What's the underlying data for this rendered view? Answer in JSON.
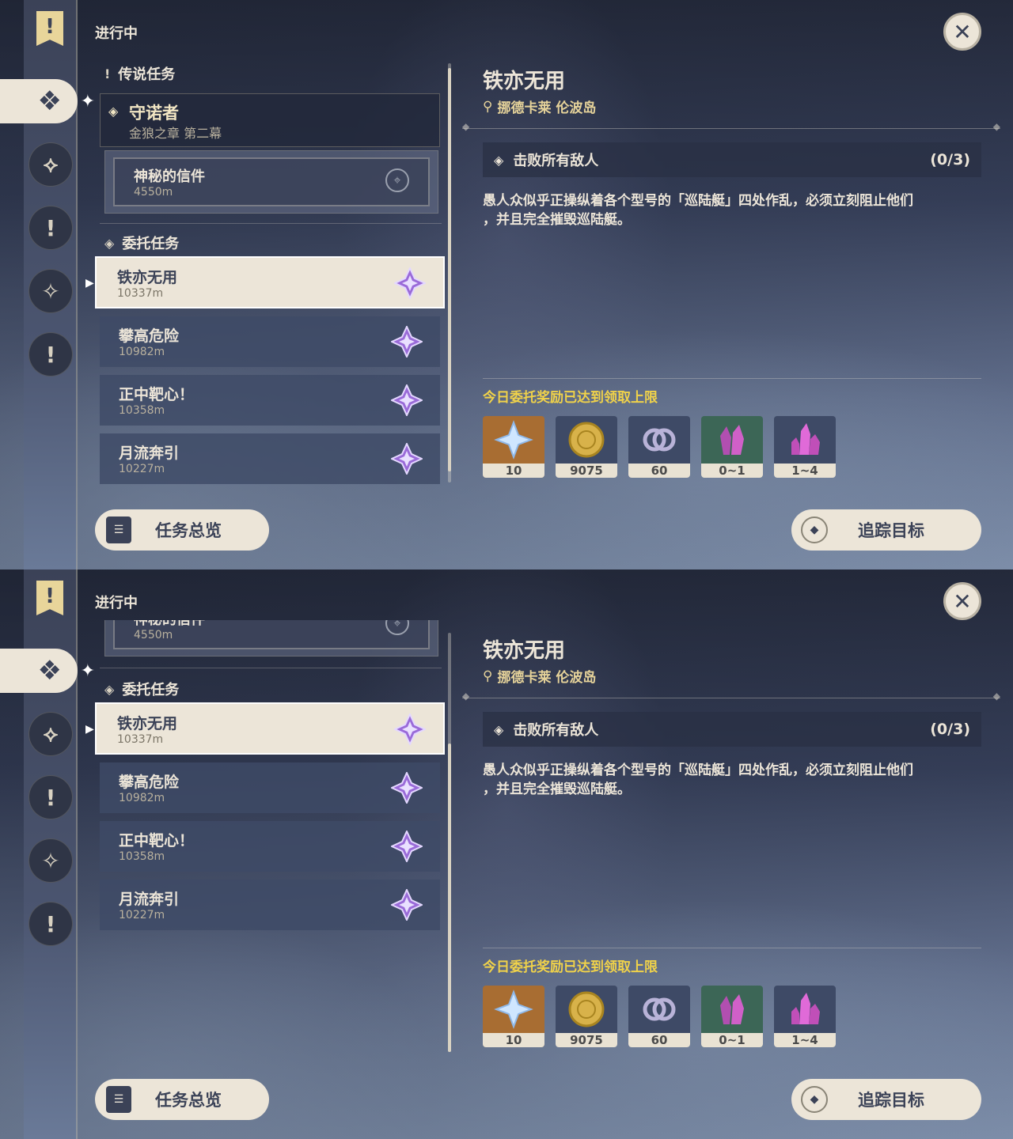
{
  "header": {
    "section_label": "进行中"
  },
  "categories": {
    "legend": "传说任务",
    "commission": "委托任务"
  },
  "legend_quest": {
    "title": "守诺者",
    "subtitle": "金狼之章 第二幕"
  },
  "legend_sub": {
    "title": "神秘的信件",
    "distance": "4550m"
  },
  "commissions": [
    {
      "title": "铁亦无用",
      "distance": "10337m",
      "selected": true
    },
    {
      "title": "攀高危险",
      "distance": "10982m"
    },
    {
      "title": "正中靶心！",
      "distance": "10358m"
    },
    {
      "title": "月流奔引",
      "distance": "10227m"
    }
  ],
  "detail": {
    "title": "铁亦无用",
    "location": "挪德卡莱 伦波岛",
    "objective": "击败所有敌人",
    "progress": "(0/3)",
    "description_line1": "愚人众似乎正操纵着各个型号的「巡陆艇」四处作乱，必须立刻阻止他们",
    "description_line2": "，并且完全摧毁巡陆艇。",
    "reward_note": "今日委托奖励已达到领取上限",
    "rewards": [
      {
        "name": "primogem-icon",
        "qty": "10",
        "bg": "#a86d32"
      },
      {
        "name": "mora-icon",
        "qty": "9075",
        "bg": "#3e4a66"
      },
      {
        "name": "adventure-exp-icon",
        "qty": "60",
        "bg": "#3e4a66"
      },
      {
        "name": "crystal-chunk-icon",
        "qty": "0~1",
        "bg": "#3c6656"
      },
      {
        "name": "crystal-cluster-icon",
        "qty": "1~4",
        "bg": "#3e4a66"
      }
    ]
  },
  "buttons": {
    "overview": "任务总览",
    "track": "追踪目标"
  },
  "colors": {
    "accent_gold": "#f0d24a",
    "panel_cream": "#ece5d8",
    "star_purple": "#9a6bd8"
  }
}
